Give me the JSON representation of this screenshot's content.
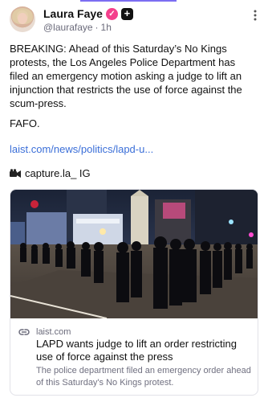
{
  "author": {
    "name": "Laura Faye",
    "handle": "@laurafaye",
    "separator": "·",
    "time": "1h",
    "verified_badge": "✓",
    "plus_badge": "+"
  },
  "post": {
    "text": "BREAKING: Ahead of this Saturday’s No Kings protests, the Los Angeles Police Department has filed an emergency motion asking a judge to lift an injunction that restricts the use of force against the scum-press.",
    "fafo": "FAFO.",
    "link": "laist.com/news/politics/lapd-u...",
    "credit": "capture.la_ IG"
  },
  "card": {
    "domain": "laist.com",
    "title": "LAPD wants judge to lift an order restricting use of force against the press",
    "description": "The police department filed an emergency order ahead of this Saturday's No Kings protest."
  },
  "colors": {
    "accent": "#7c6df2",
    "link": "#3b6fd8",
    "verified": "#f43f8c"
  },
  "icons": {
    "more": "more-vertical-icon",
    "camera": "video-camera-icon",
    "link": "chain-link-icon"
  }
}
